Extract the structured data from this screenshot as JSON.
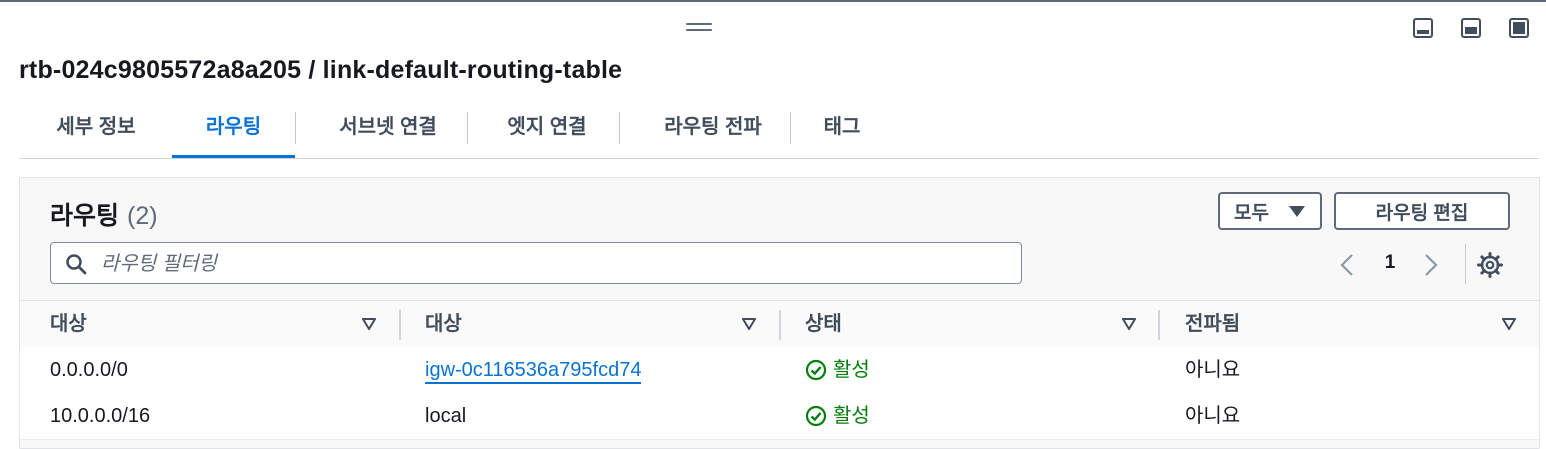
{
  "header": {
    "title": "rtb-024c9805572a8a205 / link-default-routing-table"
  },
  "tabs": [
    {
      "label": "세부 정보",
      "active": false
    },
    {
      "label": "라우팅",
      "active": true
    },
    {
      "label": "서브넷 연결",
      "active": false
    },
    {
      "label": "엣지 연결",
      "active": false
    },
    {
      "label": "라우팅 전파",
      "active": false
    },
    {
      "label": "태그",
      "active": false
    }
  ],
  "routes": {
    "title": "라우팅",
    "count": "(2)",
    "filter_button": "모두",
    "edit_button": "라우팅 편집",
    "search_placeholder": "라우팅 필터링",
    "page": "1",
    "columns": [
      "대상",
      "대상",
      "상태",
      "전파됨"
    ],
    "rows": [
      {
        "destination": "0.0.0.0/0",
        "target": "igw-0c116536a795fcd74",
        "target_is_link": true,
        "status": "활성",
        "propagated": "아니요"
      },
      {
        "destination": "10.0.0.0/16",
        "target": "local",
        "target_is_link": false,
        "status": "활성",
        "propagated": "아니요"
      }
    ]
  },
  "colors": {
    "accent": "#0972d3",
    "success": "#037f0c",
    "text": "#16191f"
  }
}
